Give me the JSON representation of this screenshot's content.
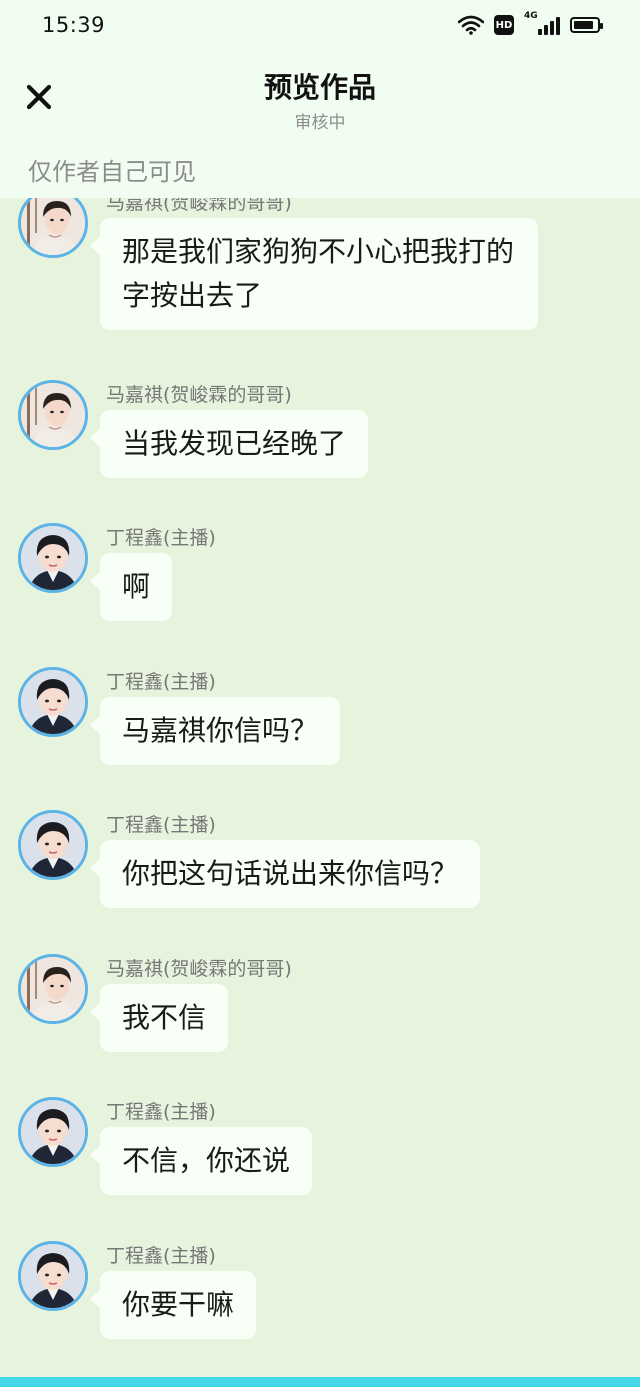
{
  "status_bar": {
    "time": "15:39",
    "network_badge": "HD",
    "signal_label": "4G",
    "battery_level": 0.85
  },
  "header": {
    "title": "预览作品",
    "subtitle": "审核中",
    "close_icon": "close-icon"
  },
  "visibility_note": "仅作者自己可见",
  "messages": [
    {
      "user": "马嘉祺(贺峻霖的哥哥)",
      "text": "那是我们家狗狗不小心把我打的字按出去了",
      "avatar": "avatar-majiaqi"
    },
    {
      "user": "马嘉祺(贺峻霖的哥哥)",
      "text": "当我发现已经晚了",
      "avatar": "avatar-majiaqi"
    },
    {
      "user": "丁程鑫(主播)",
      "text": "啊",
      "avatar": "avatar-dingchengxin"
    },
    {
      "user": "丁程鑫(主播)",
      "text": "马嘉祺你信吗？",
      "avatar": "avatar-dingchengxin"
    },
    {
      "user": "丁程鑫(主播)",
      "text": "你把这句话说出来你信吗？",
      "avatar": "avatar-dingchengxin"
    },
    {
      "user": "马嘉祺(贺峻霖的哥哥)",
      "text": "我不信",
      "avatar": "avatar-majiaqi"
    },
    {
      "user": "丁程鑫(主播)",
      "text": "不信，你还说",
      "avatar": "avatar-dingchengxin"
    },
    {
      "user": "丁程鑫(主播)",
      "text": "你要干嘛",
      "avatar": "avatar-dingchengxin"
    }
  ],
  "colors": {
    "top_bg": "#f2fdf1",
    "chat_bg": "#e6f4de",
    "bubble_bg": "#f8fff6",
    "avatar_ring": "#5bb3e6",
    "bottom_accent": "#45d8e8"
  }
}
